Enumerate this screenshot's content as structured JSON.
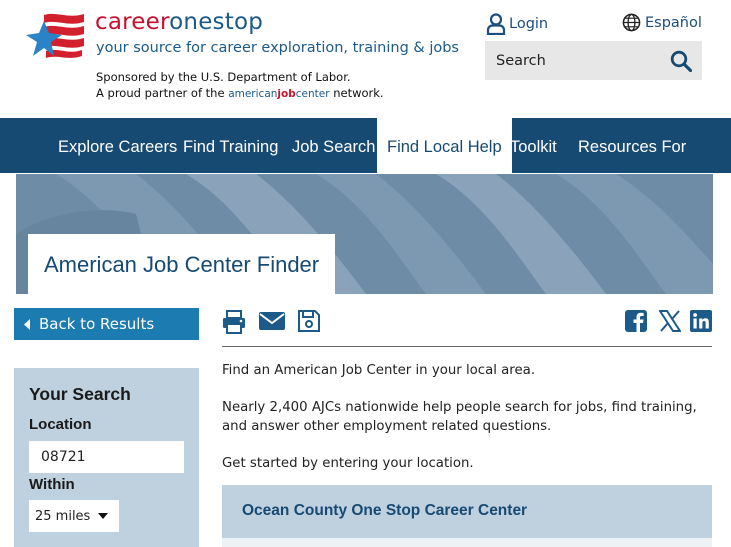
{
  "header": {
    "brand_part1": "career",
    "brand_part2": "onestop",
    "tagline": "your source for career exploration, training & jobs",
    "sponsor_line1": "Sponsored by the U.S. Department of Labor.",
    "sponsor_line2_prefix": "A proud partner of the",
    "ajc_part1": "american",
    "ajc_part2": "job",
    "ajc_part3": "center",
    "sponsor_line2_suffix": "network.",
    "login_label": "Login",
    "language_label": "Español",
    "search_placeholder": "Search",
    "search_icon": "magnifier-icon"
  },
  "nav": {
    "items": [
      {
        "label": "Explore Careers"
      },
      {
        "label": "Find Training"
      },
      {
        "label": "Job Search"
      },
      {
        "label": "Find Local Help",
        "active": true
      },
      {
        "label": "Toolkit"
      },
      {
        "label": "Resources For"
      }
    ]
  },
  "hero": {
    "title": "American Job Center Finder"
  },
  "sidebar": {
    "back_label": "Back to Results",
    "panel_title": "Your Search",
    "location_label": "Location",
    "location_value": "08721",
    "within_label": "Within",
    "within_value": "25 miles"
  },
  "toolbar": {
    "icons": [
      "print-icon",
      "email-icon",
      "save-icon"
    ],
    "share_icons": [
      "facebook-icon",
      "x-icon",
      "linkedin-icon"
    ]
  },
  "main": {
    "intro": "Find an American Job Center in your local area.",
    "description": "Nearly 2,400 AJCs nationwide help people search for jobs, find training, and answer other employment related questions.",
    "cta": "Get started by entering your location.",
    "results": [
      {
        "name": "Ocean County One Stop Career Center"
      }
    ]
  },
  "colors": {
    "brand_red": "#c8102e",
    "brand_blue": "#1c5a8a",
    "nav_bg": "#174a73",
    "back_button": "#1c7bb0",
    "panel_bg": "#bfd0df",
    "hero_bg": "#6f8ca7"
  }
}
